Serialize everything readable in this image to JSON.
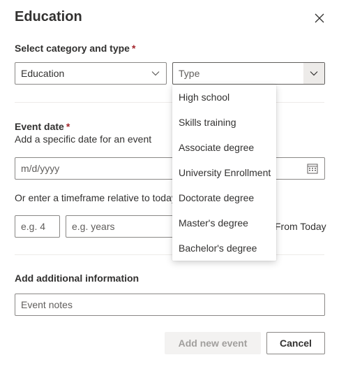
{
  "dialog": {
    "title": "Education",
    "close_icon": "close-icon"
  },
  "category": {
    "label": "Select category and type",
    "required_mark": "*",
    "category_value": "Education",
    "type_placeholder": "Type",
    "type_options": [
      "High school",
      "Skills training",
      "Associate degree",
      "University Enrollment",
      "Doctorate degree",
      "Master's degree",
      "Bachelor's degree"
    ]
  },
  "event_date": {
    "label": "Event date",
    "required_mark": "*",
    "helper": "Add a specific date for an event",
    "date_placeholder": "m/d/yyyy",
    "calendar_icon": "calendar-icon"
  },
  "timeframe": {
    "helper": "Or enter a timeframe relative to today",
    "amount_placeholder": "e.g. 4",
    "unit_placeholder": "e.g. years",
    "from_today": "From Today"
  },
  "additional": {
    "label": "Add additional information",
    "notes_placeholder": "Event notes"
  },
  "actions": {
    "add_label": "Add new event",
    "cancel_label": "Cancel"
  }
}
